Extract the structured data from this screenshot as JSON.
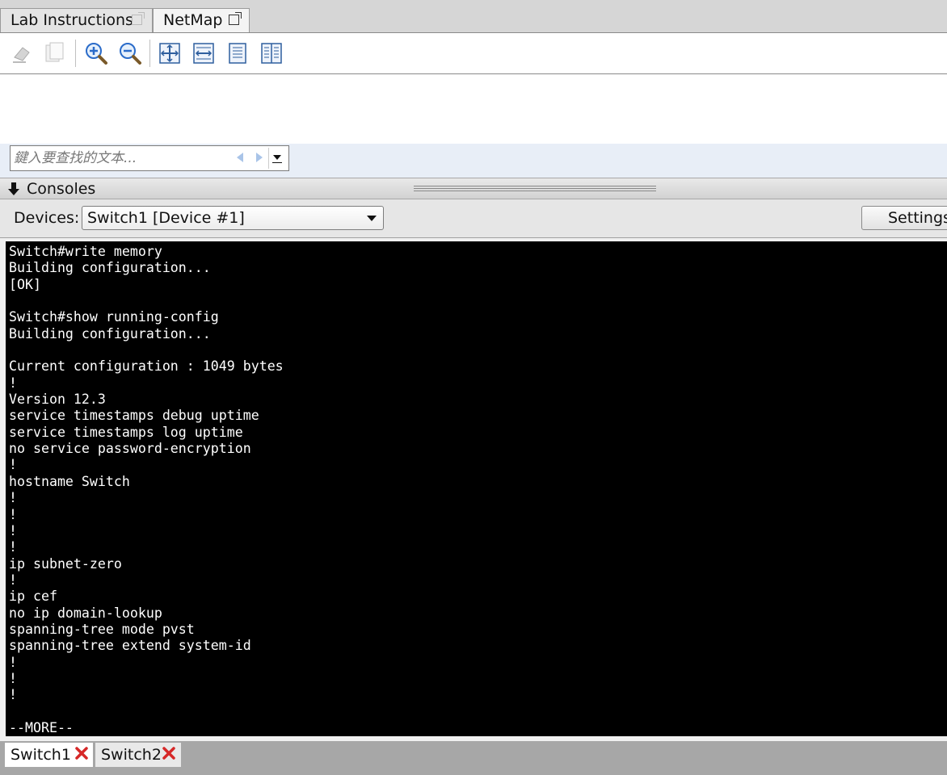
{
  "tabs": [
    {
      "label": "Lab Instructions"
    },
    {
      "label": "NetMap"
    }
  ],
  "toolbar": {
    "icons": [
      "eraser-icon",
      "copy-icon",
      "zoom-in-icon",
      "zoom-out-icon",
      "fit-page-icon",
      "fit-width-icon",
      "single-page-icon",
      "two-page-icon"
    ]
  },
  "find": {
    "placeholder": "鍵入要查找的文本..."
  },
  "consoles": {
    "header_label": "Consoles"
  },
  "devices": {
    "label": "Devices:",
    "selected": "Switch1 [Device #1]",
    "settings_label": "Settings..."
  },
  "terminal": {
    "lines": [
      "Switch#write memory",
      "Building configuration...",
      "[OK]",
      "",
      "Switch#show running-config",
      "Building configuration...",
      "",
      "Current configuration : 1049 bytes",
      "!",
      "Version 12.3",
      "service timestamps debug uptime",
      "service timestamps log uptime",
      "no service password-encryption",
      "!",
      "hostname Switch",
      "!",
      "!",
      "!",
      "!",
      "ip subnet-zero",
      "!",
      "ip cef",
      "no ip domain-lookup",
      "spanning-tree mode pvst",
      "spanning-tree extend system-id",
      "!",
      "!",
      "!",
      "",
      "--MORE--"
    ]
  },
  "console_tabs": [
    {
      "label": "Switch1"
    },
    {
      "label": "Switch2"
    }
  ],
  "colors": {
    "terminal_bg": "#000000",
    "terminal_fg": "#ffffff",
    "close_red": "#d62828",
    "zoom_blue": "#2a6bc9"
  }
}
